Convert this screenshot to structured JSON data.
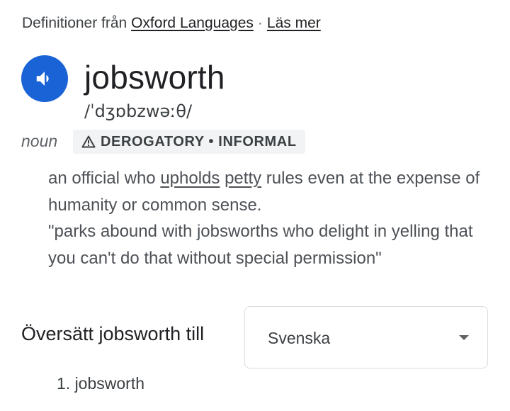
{
  "source": {
    "prefix": "Definitioner från",
    "provider_link": "Oxford Languages",
    "separator": "·",
    "more_link": "Läs mer"
  },
  "entry": {
    "speaker_icon": "volume-up-icon",
    "accent_color": "#1a63d6",
    "word": "jobsworth",
    "phonetic": "/ˈdʒɒbzwəːθ/",
    "part_of_speech": "noun",
    "register": {
      "icon": "warning-triangle-icon",
      "label": "DEROGATORY • INFORMAL"
    },
    "definition": {
      "part1": "an official who ",
      "link1": "upholds",
      "part2": " ",
      "link2": "petty",
      "part3": " rules even at the expense of humanity or common sense."
    },
    "example": "\"parks abound with jobsworths who delight in yelling that you can't do that without special permission\""
  },
  "translate": {
    "label": "Översätt jobsworth till",
    "selected_language": "Svenska",
    "results": [
      "1. jobsworth"
    ]
  }
}
